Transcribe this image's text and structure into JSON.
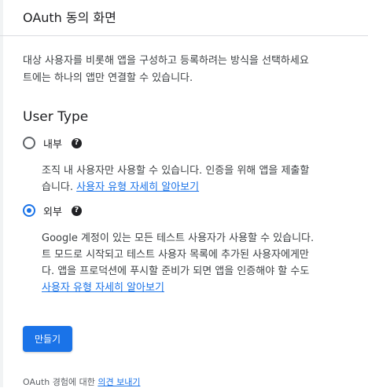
{
  "header": {
    "title": "OAuth 동의 화면"
  },
  "intro": {
    "line1": "대상 사용자를 비롯해 앱을 구성하고 등록하려는 방식을 선택하세요",
    "line2": "트에는 하나의 앱만 연결할 수 있습니다."
  },
  "user_type": {
    "title": "User Type",
    "options": [
      {
        "label": "내부",
        "selected": false,
        "desc_line1": "조직 내 사용자만 사용할 수 있습니다. 인증을 위해 앱을 제출할",
        "desc_line2_prefix": "습니다. ",
        "link": "사용자 유형 자세히 알아보기"
      },
      {
        "label": "외부",
        "selected": true,
        "desc_line1": "Google 계정이 있는 모든 테스트 사용자가 사용할 수 있습니다.",
        "desc_line2": "트 모드로 시작되고 테스트 사용자 목록에 추가된 사용자에게만",
        "desc_line3": "다. 앱을 프로덕션에 푸시할 준비가 되면 앱을 인증해야 할 수도",
        "link": "사용자 유형 자세히 알아보기"
      }
    ]
  },
  "actions": {
    "create_label": "만들기"
  },
  "footer": {
    "prefix": "OAuth 경험에 대한 ",
    "link": "의견 보내기"
  },
  "icons": {
    "help": "help-circle-icon"
  },
  "colors": {
    "accent": "#1a73e8",
    "text": "#202124",
    "muted": "#3c4043"
  }
}
